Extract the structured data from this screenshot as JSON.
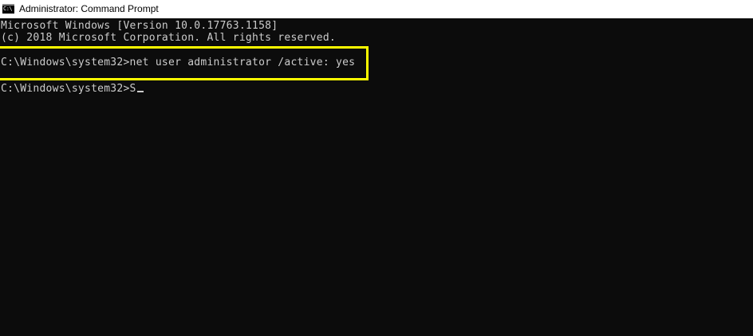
{
  "window": {
    "title": "Administrator: Command Prompt",
    "icon": "cmd-icon",
    "icon_glyph": "C:\\"
  },
  "console": {
    "lines": [
      "Microsoft Windows [Version 10.0.17763.1158]",
      "(c) 2018 Microsoft Corporation. All rights reserved.",
      "C:\\Windows\\system32>net user administrator /active: yes",
      "C:\\Windows\\system32>S"
    ]
  },
  "colors": {
    "background": "#0c0c0c",
    "text": "#cccccc",
    "highlight": "#ffff00",
    "titlebar": "#ffffff"
  }
}
